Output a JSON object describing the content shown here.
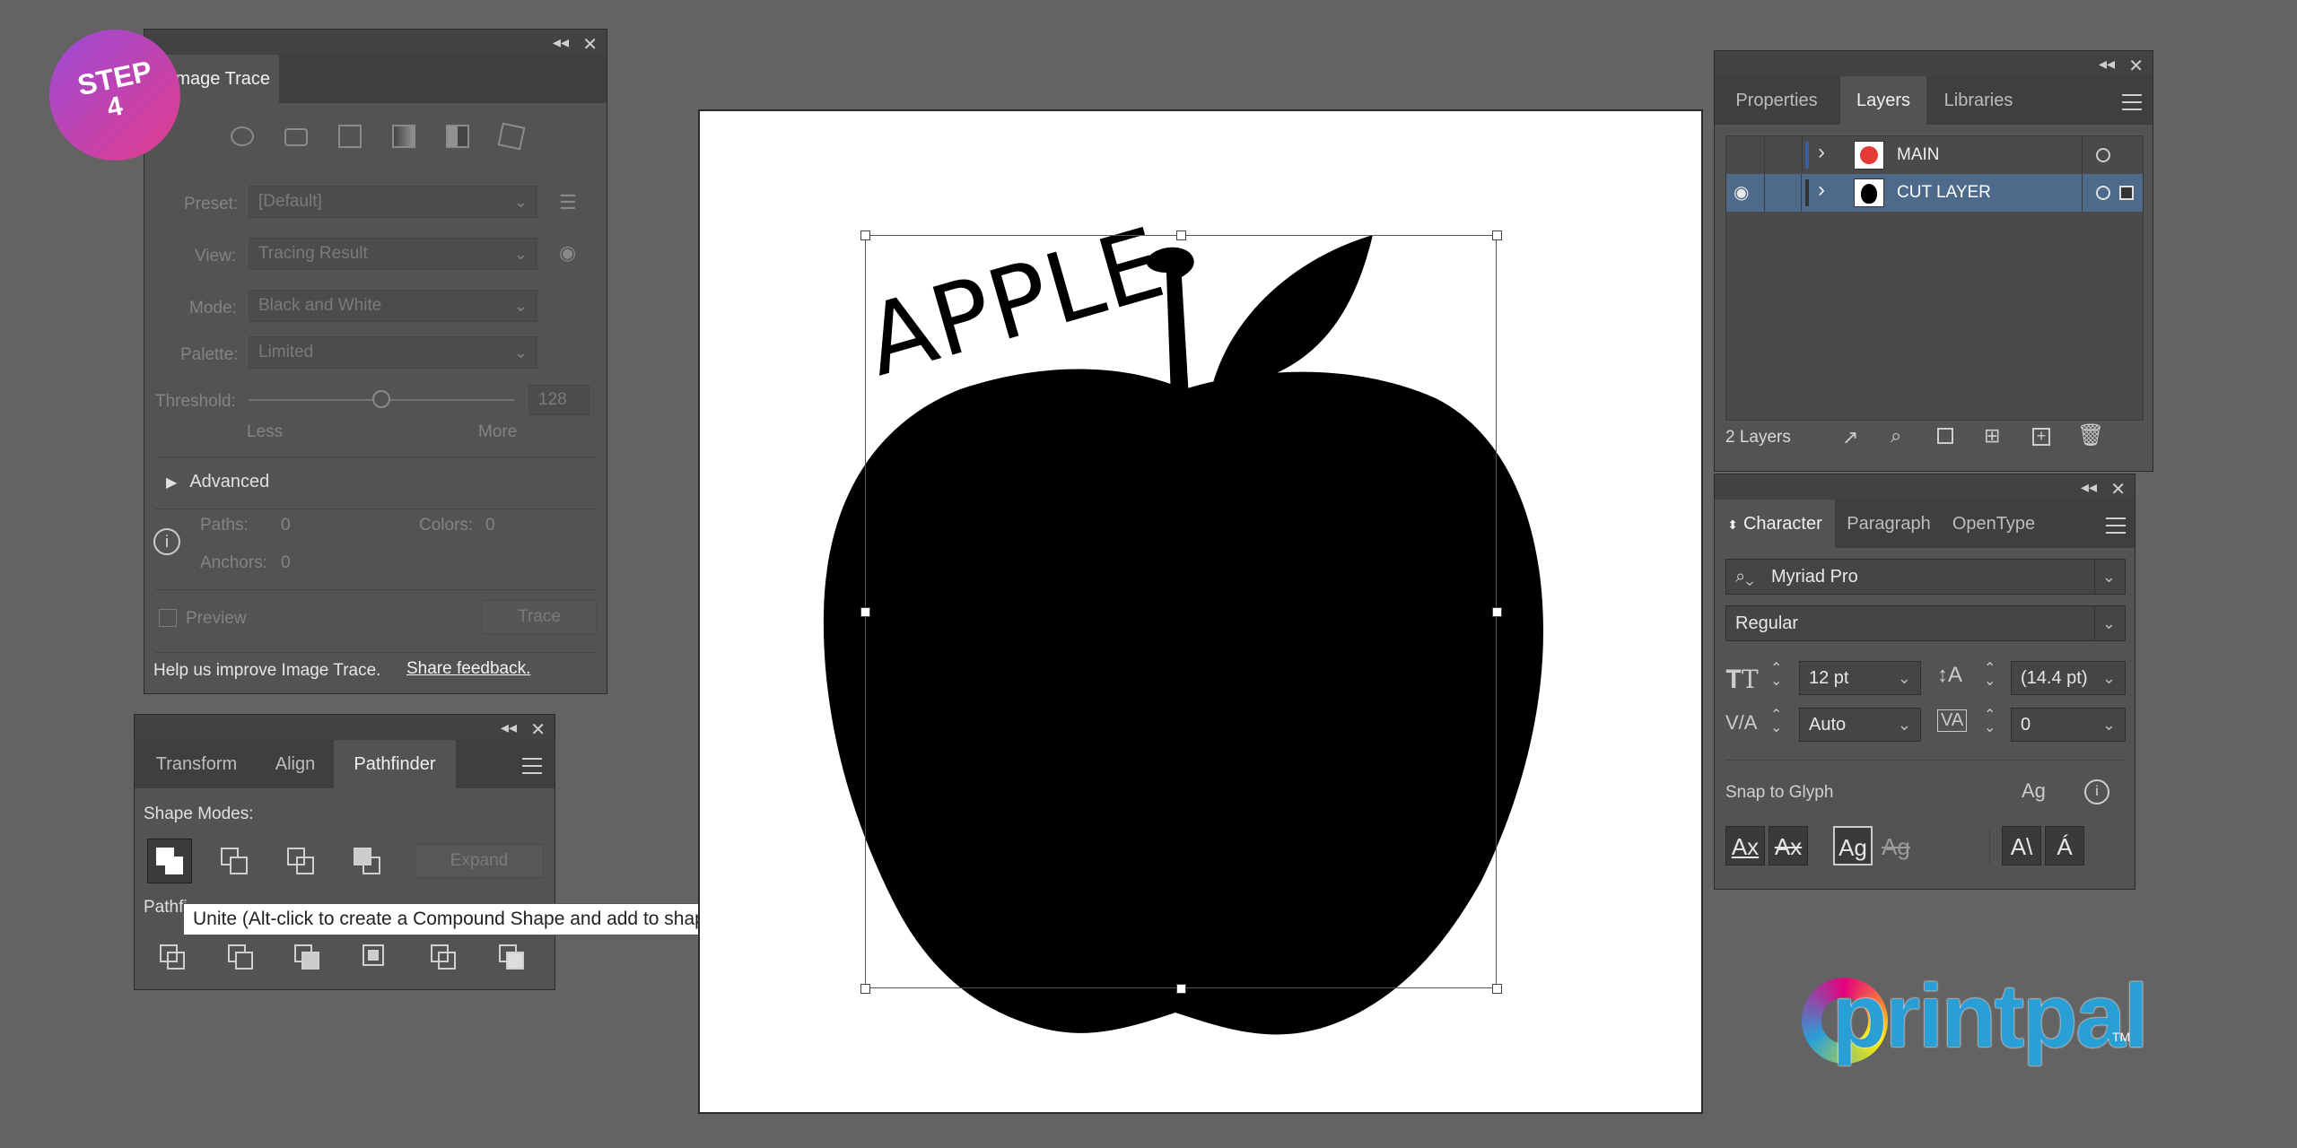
{
  "step_badge": {
    "line1": "STEP",
    "line2": "4"
  },
  "image_trace": {
    "tab": "Image Trace",
    "preset_label": "Preset:",
    "preset_value": "[Default]",
    "view_label": "View:",
    "view_value": "Tracing Result",
    "mode_label": "Mode:",
    "mode_value": "Black and White",
    "palette_label": "Palette:",
    "palette_value": "Limited",
    "threshold_label": "Threshold:",
    "threshold_value": "128",
    "threshold_level": 0.5,
    "less": "Less",
    "more": "More",
    "advanced": "Advanced",
    "paths_label": "Paths:",
    "paths_value": "0",
    "colors_label": "Colors:",
    "colors_value": "0",
    "anchors_label": "Anchors:",
    "anchors_value": "0",
    "preview": "Preview",
    "trace_button": "Trace",
    "feedback_text": "Help us improve Image Trace.",
    "feedback_link": "Share feedback."
  },
  "pathfinder": {
    "tabs": [
      "Transform",
      "Align",
      "Pathfinder"
    ],
    "active_tab": "Pathfinder",
    "shape_modes_label": "Shape Modes:",
    "pathfinders_label": "Pathfi",
    "expand_button": "Expand",
    "tooltip": "Unite (Alt-click to create a Compound Shape and add to shape area)"
  },
  "canvas": {
    "artwork_text": "APPLE"
  },
  "layers_panel": {
    "tabs": [
      "Properties",
      "Layers",
      "Libraries"
    ],
    "active_tab": "Layers",
    "layers": [
      {
        "name": "MAIN",
        "visible": false,
        "selected": false,
        "thumb_color": "#e53935"
      },
      {
        "name": "CUT LAYER",
        "visible": true,
        "selected": true,
        "thumb_color": "#000000"
      }
    ],
    "count": "2 Layers"
  },
  "character_panel": {
    "tabs": [
      "Character",
      "Paragraph",
      "OpenType"
    ],
    "active_tab": "Character",
    "font_family": "Myriad Pro",
    "font_style": "Regular",
    "font_size": "12 pt",
    "leading": "(14.4 pt)",
    "kerning": "Auto",
    "tracking": "0",
    "snap_to_glyph": "Snap to Glyph"
  },
  "logo": {
    "text": "printpal",
    "tm": "TM",
    "color": "#2a9fd6"
  },
  "colors": {
    "selection": "#4d6a8a",
    "canvas": "#ffffff",
    "badge_from": "#9b4bd6",
    "badge_to": "#e23c8c"
  }
}
